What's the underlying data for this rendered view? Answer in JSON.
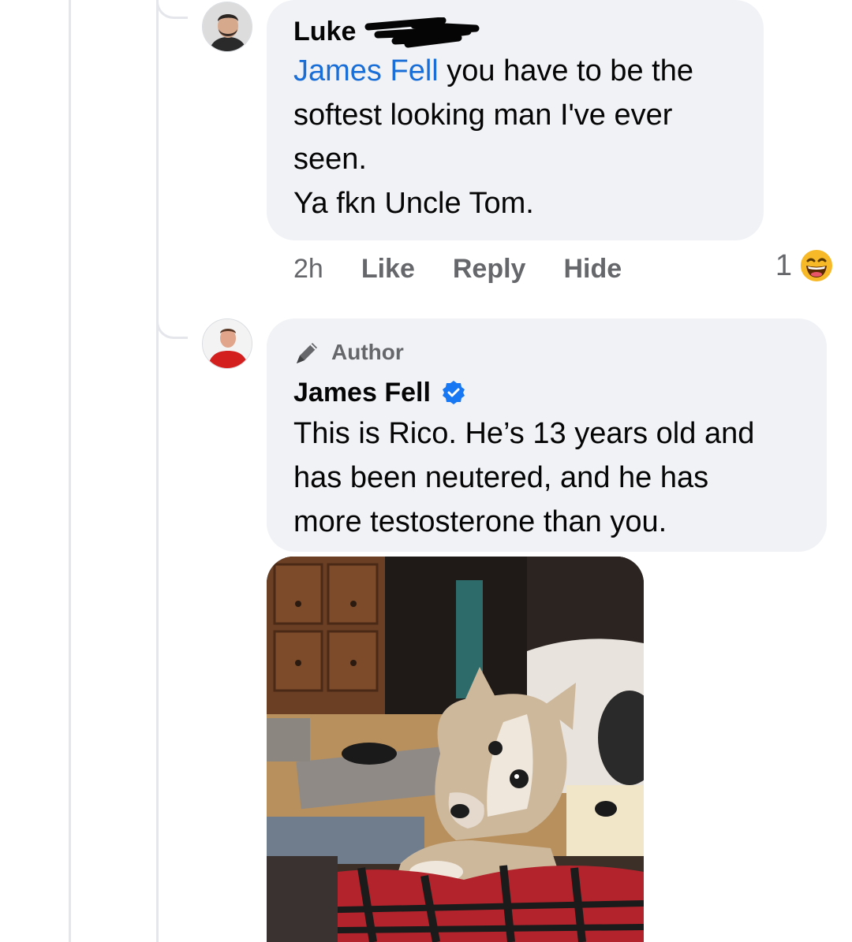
{
  "comments": [
    {
      "author": "Luke",
      "mention": "James Fell",
      "text_lines": [
        " you have to be the",
        "softest looking man I've ever",
        "seen.",
        "Ya fkn Uncle Tom."
      ],
      "time": "2h",
      "actions": {
        "like": "Like",
        "reply": "Reply",
        "hide": "Hide"
      },
      "reaction_count": "1",
      "reaction_icon": "laughing-emoji-icon"
    },
    {
      "badge": "Author",
      "author": "James Fell",
      "verified_icon": "verified-badge-icon",
      "text_lines": [
        "This is Rico. He’s 13 years old and",
        "has been neutered, and he has",
        "more testosterone than you."
      ],
      "attachment": "photo of a small tan chihuahua-mix dog on a couch"
    }
  ],
  "colors": {
    "bubble": "#f0f2f5",
    "mention": "#1a6ed8",
    "secondary_text": "#65676b",
    "verified": "#1877f2",
    "thread_line": "#e4e6eb"
  }
}
